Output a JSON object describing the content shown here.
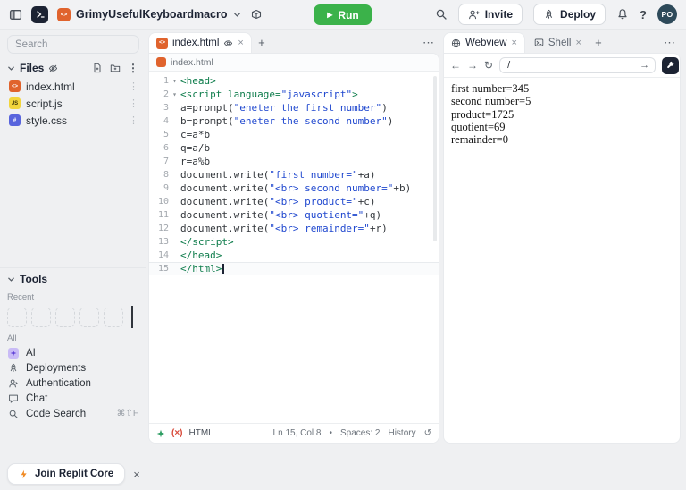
{
  "colors": {
    "run_green": "#3bb24a",
    "repl_orange": "#e0632d",
    "js_yellow": "#f2d53c",
    "css_blue": "#5864dd",
    "avatar_bg": "#2e4a5a",
    "tag_green": "#0f7d4c",
    "string_blue": "#2048cf",
    "plain_code": "#33373c",
    "error_red": "#d84a3a",
    "ai_purple": "#c9bbf6",
    "bolt_orange": "#f08b26"
  },
  "glyphs": {
    "play": "▶",
    "close": "×",
    "plus": "+",
    "more": "⋯",
    "kebab": "⋮",
    "question": "?",
    "back": "←",
    "forward": "→",
    "go": "→",
    "reload": "↻",
    "history": "↺",
    "bullet": "•",
    "fold": "▾"
  },
  "header": {
    "title": "GrimyUsefulKeyboardmacro",
    "run": "Run",
    "invite": "Invite",
    "deploy": "Deploy",
    "avatar": "PO"
  },
  "sidebar": {
    "search_placeholder": "Search",
    "files_label": "Files",
    "files": [
      {
        "name": "index.html",
        "glyph": "<>"
      },
      {
        "name": "script.js",
        "glyph": "JS"
      },
      {
        "name": "style.css",
        "glyph": "#"
      }
    ],
    "tools_label": "Tools",
    "recent_label": "Recent",
    "all_label": "All",
    "tools": [
      {
        "label": "AI"
      },
      {
        "label": "Deployments"
      },
      {
        "label": "Authentication"
      },
      {
        "label": "Chat"
      },
      {
        "label": "Code Search",
        "shortcut": "⌘⇧F"
      }
    ],
    "join_button": "Join Replit Core"
  },
  "editor": {
    "tab_label": "index.html",
    "breadcrumb": "index.html",
    "status": {
      "lang_badge": "(×)",
      "lang": "HTML",
      "cursor": "Ln 15, Col 8",
      "spaces": "Spaces: 2",
      "history": "History"
    },
    "lines": [
      {
        "n": "1",
        "fold": true,
        "t": [
          [
            "t",
            "<head>"
          ]
        ]
      },
      {
        "n": "2",
        "fold": true,
        "t": [
          [
            "t",
            "<script "
          ],
          [
            "t",
            "language="
          ],
          [
            "s",
            "\"javascript\""
          ],
          [
            "t",
            ">"
          ]
        ]
      },
      {
        "n": "3",
        "t": [
          [
            "p",
            "a=prompt("
          ],
          [
            "s",
            "\"eneter the first number\""
          ],
          [
            "p",
            ")"
          ]
        ]
      },
      {
        "n": "4",
        "t": [
          [
            "p",
            "b=prompt("
          ],
          [
            "s",
            "\"eneter the second number\""
          ],
          [
            "p",
            ")"
          ]
        ]
      },
      {
        "n": "5",
        "t": [
          [
            "p",
            "c=a*b"
          ]
        ]
      },
      {
        "n": "6",
        "t": [
          [
            "p",
            "q=a/b"
          ]
        ]
      },
      {
        "n": "7",
        "t": [
          [
            "p",
            "r=a%b"
          ]
        ]
      },
      {
        "n": "8",
        "t": [
          [
            "p",
            "document.write("
          ],
          [
            "s",
            "\"first number=\""
          ],
          [
            "p",
            "+a)"
          ]
        ]
      },
      {
        "n": "9",
        "t": [
          [
            "p",
            "document.write("
          ],
          [
            "s",
            "\"<br> second number=\""
          ],
          [
            "p",
            "+b)"
          ]
        ]
      },
      {
        "n": "10",
        "t": [
          [
            "p",
            "document.write("
          ],
          [
            "s",
            "\"<br> product=\""
          ],
          [
            "p",
            "+c)"
          ]
        ]
      },
      {
        "n": "11",
        "t": [
          [
            "p",
            "document.write("
          ],
          [
            "s",
            "\"<br> quotient=\""
          ],
          [
            "p",
            "+q)"
          ]
        ]
      },
      {
        "n": "12",
        "t": [
          [
            "p",
            "document.write("
          ],
          [
            "s",
            "\"<br> remainder=\""
          ],
          [
            "p",
            "+r)"
          ]
        ]
      },
      {
        "n": "13",
        "t": [
          [
            "t",
            "</script>"
          ]
        ]
      },
      {
        "n": "14",
        "t": [
          [
            "t",
            "</head>"
          ]
        ]
      },
      {
        "n": "15",
        "cur": true,
        "t": [
          [
            "t",
            "</html>"
          ]
        ]
      }
    ]
  },
  "webview": {
    "webview_tab": "Webview",
    "shell_tab": "Shell",
    "url": "/",
    "output": [
      "first number=345",
      "second number=5",
      "product=1725",
      "quotient=69",
      "remainder=0"
    ]
  }
}
